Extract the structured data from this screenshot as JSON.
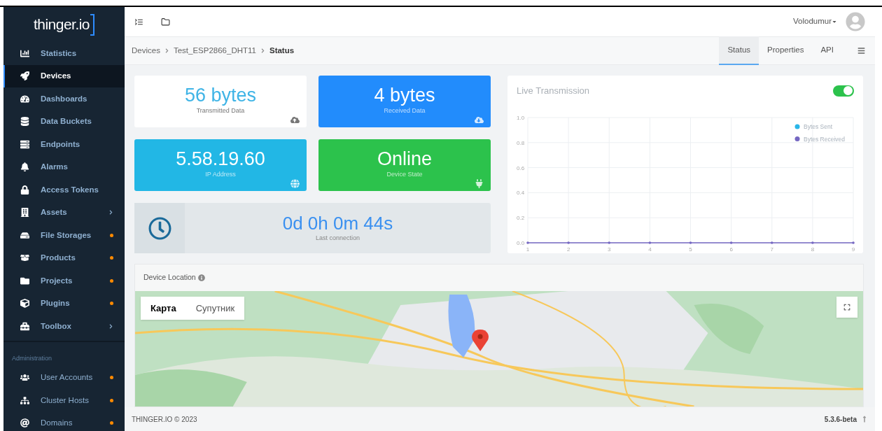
{
  "logo": {
    "text": "thinger.io"
  },
  "sidebar": {
    "items": [
      {
        "label": "Statistics",
        "selected": false
      },
      {
        "label": "Devices",
        "selected": true
      },
      {
        "label": "Dashboards",
        "selected": false
      },
      {
        "label": "Data Buckets",
        "selected": false
      },
      {
        "label": "Endpoints",
        "selected": false
      },
      {
        "label": "Alarms",
        "selected": false
      },
      {
        "label": "Access Tokens",
        "selected": false
      },
      {
        "label": "Assets",
        "selected": false,
        "kind": "submenu"
      },
      {
        "label": "File Storages",
        "selected": false,
        "kind": "dot"
      },
      {
        "label": "Products",
        "selected": false,
        "kind": "dot"
      },
      {
        "label": "Projects",
        "selected": false,
        "kind": "dot"
      },
      {
        "label": "Plugins",
        "selected": false,
        "kind": "dot"
      },
      {
        "label": "Toolbox",
        "selected": false,
        "kind": "submenu"
      }
    ],
    "section": "Administration",
    "admin_items": [
      {
        "label": "User Accounts",
        "selected": false,
        "kind": "dot"
      },
      {
        "label": "Cluster Hosts",
        "selected": false,
        "kind": "dot"
      },
      {
        "label": "Domains",
        "selected": false,
        "kind": "dot"
      }
    ]
  },
  "user": {
    "name": "Volodumur"
  },
  "breadcrumb": [
    "Devices",
    "Test_ESP2866_DHT11",
    "Status"
  ],
  "tabs": [
    {
      "label": "Status",
      "selected": true
    },
    {
      "label": "Properties",
      "selected": false
    },
    {
      "label": "API",
      "selected": false
    }
  ],
  "stats": [
    {
      "value": "56 bytes",
      "label": "Transmitted Data",
      "kind": "upload",
      "color": "#ffffff"
    },
    {
      "value": "4 bytes",
      "label": "Received Data",
      "kind": "download",
      "color": "#228cfc"
    },
    {
      "value": "5.58.19.60",
      "label": "IP Address",
      "kind": "globe",
      "color": "#22b7e5"
    },
    {
      "value": "Online",
      "label": "Device State",
      "kind": "plug",
      "color": "#2cc24c"
    }
  ],
  "last_connection": {
    "value": "0d 0h 0m 44s",
    "label": "Last connection"
  },
  "live": {
    "title": "Live Transmission",
    "on": true,
    "chart_data": {
      "type": "line",
      "grid": true,
      "legend": true,
      "x": [
        1,
        2,
        3,
        4,
        5,
        6,
        7,
        8,
        9
      ],
      "xlim": [
        1,
        9
      ],
      "xticks": [
        1,
        2,
        3,
        4,
        5,
        6,
        7,
        8,
        9
      ],
      "ylim": [
        0,
        1
      ],
      "yticks": [
        {
          "value": 0,
          "label": "0.0"
        },
        {
          "value": 0.2,
          "label": "0.2"
        },
        {
          "value": 0.4,
          "label": "0.4"
        },
        {
          "value": 0.6,
          "label": "0.6"
        },
        {
          "value": 0.8,
          "label": "0.8"
        },
        {
          "value": 1,
          "label": "1.0"
        }
      ],
      "series": [
        {
          "name": "Bytes Sent",
          "color": "#29b6e8",
          "values": [
            null,
            null,
            null,
            null,
            null,
            null,
            null,
            null,
            null
          ]
        },
        {
          "name": "Bytes Received",
          "color": "#7567c2",
          "values": [
            0,
            0,
            0,
            0,
            0,
            0,
            0,
            0,
            0
          ]
        }
      ]
    }
  },
  "location": {
    "title": "Device Location",
    "map_types": [
      {
        "label": "Карта",
        "selected": true
      },
      {
        "label": "Супутник",
        "selected": false
      }
    ]
  },
  "footer": {
    "copyright": "THINGER.IO © 2023",
    "version": "5.3.6-beta"
  }
}
